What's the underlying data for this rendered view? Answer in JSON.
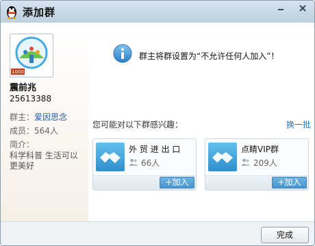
{
  "window": {
    "title": "添加群"
  },
  "group": {
    "name": "震前兆",
    "id": "25613388",
    "level_badge": "1000",
    "owner_label": "群主：",
    "owner_name": "爱因思念",
    "members_label": "成员：",
    "members_value": "564人",
    "intro_label": "简介：",
    "intro_text": "科学科普 生活可以更美好"
  },
  "notice": {
    "text": "群主将群设置为“不允许任何人加入”！"
  },
  "recommend": {
    "title": "您可能对以下群感兴趣：",
    "refresh_label": "换一批",
    "cards": [
      {
        "name": "外 贸 进 出 口",
        "count": "66人",
        "join_label": "加入"
      },
      {
        "name": "点睛VIP群",
        "count": "209人",
        "join_label": "加入"
      }
    ]
  },
  "footer": {
    "done_label": "完成"
  }
}
